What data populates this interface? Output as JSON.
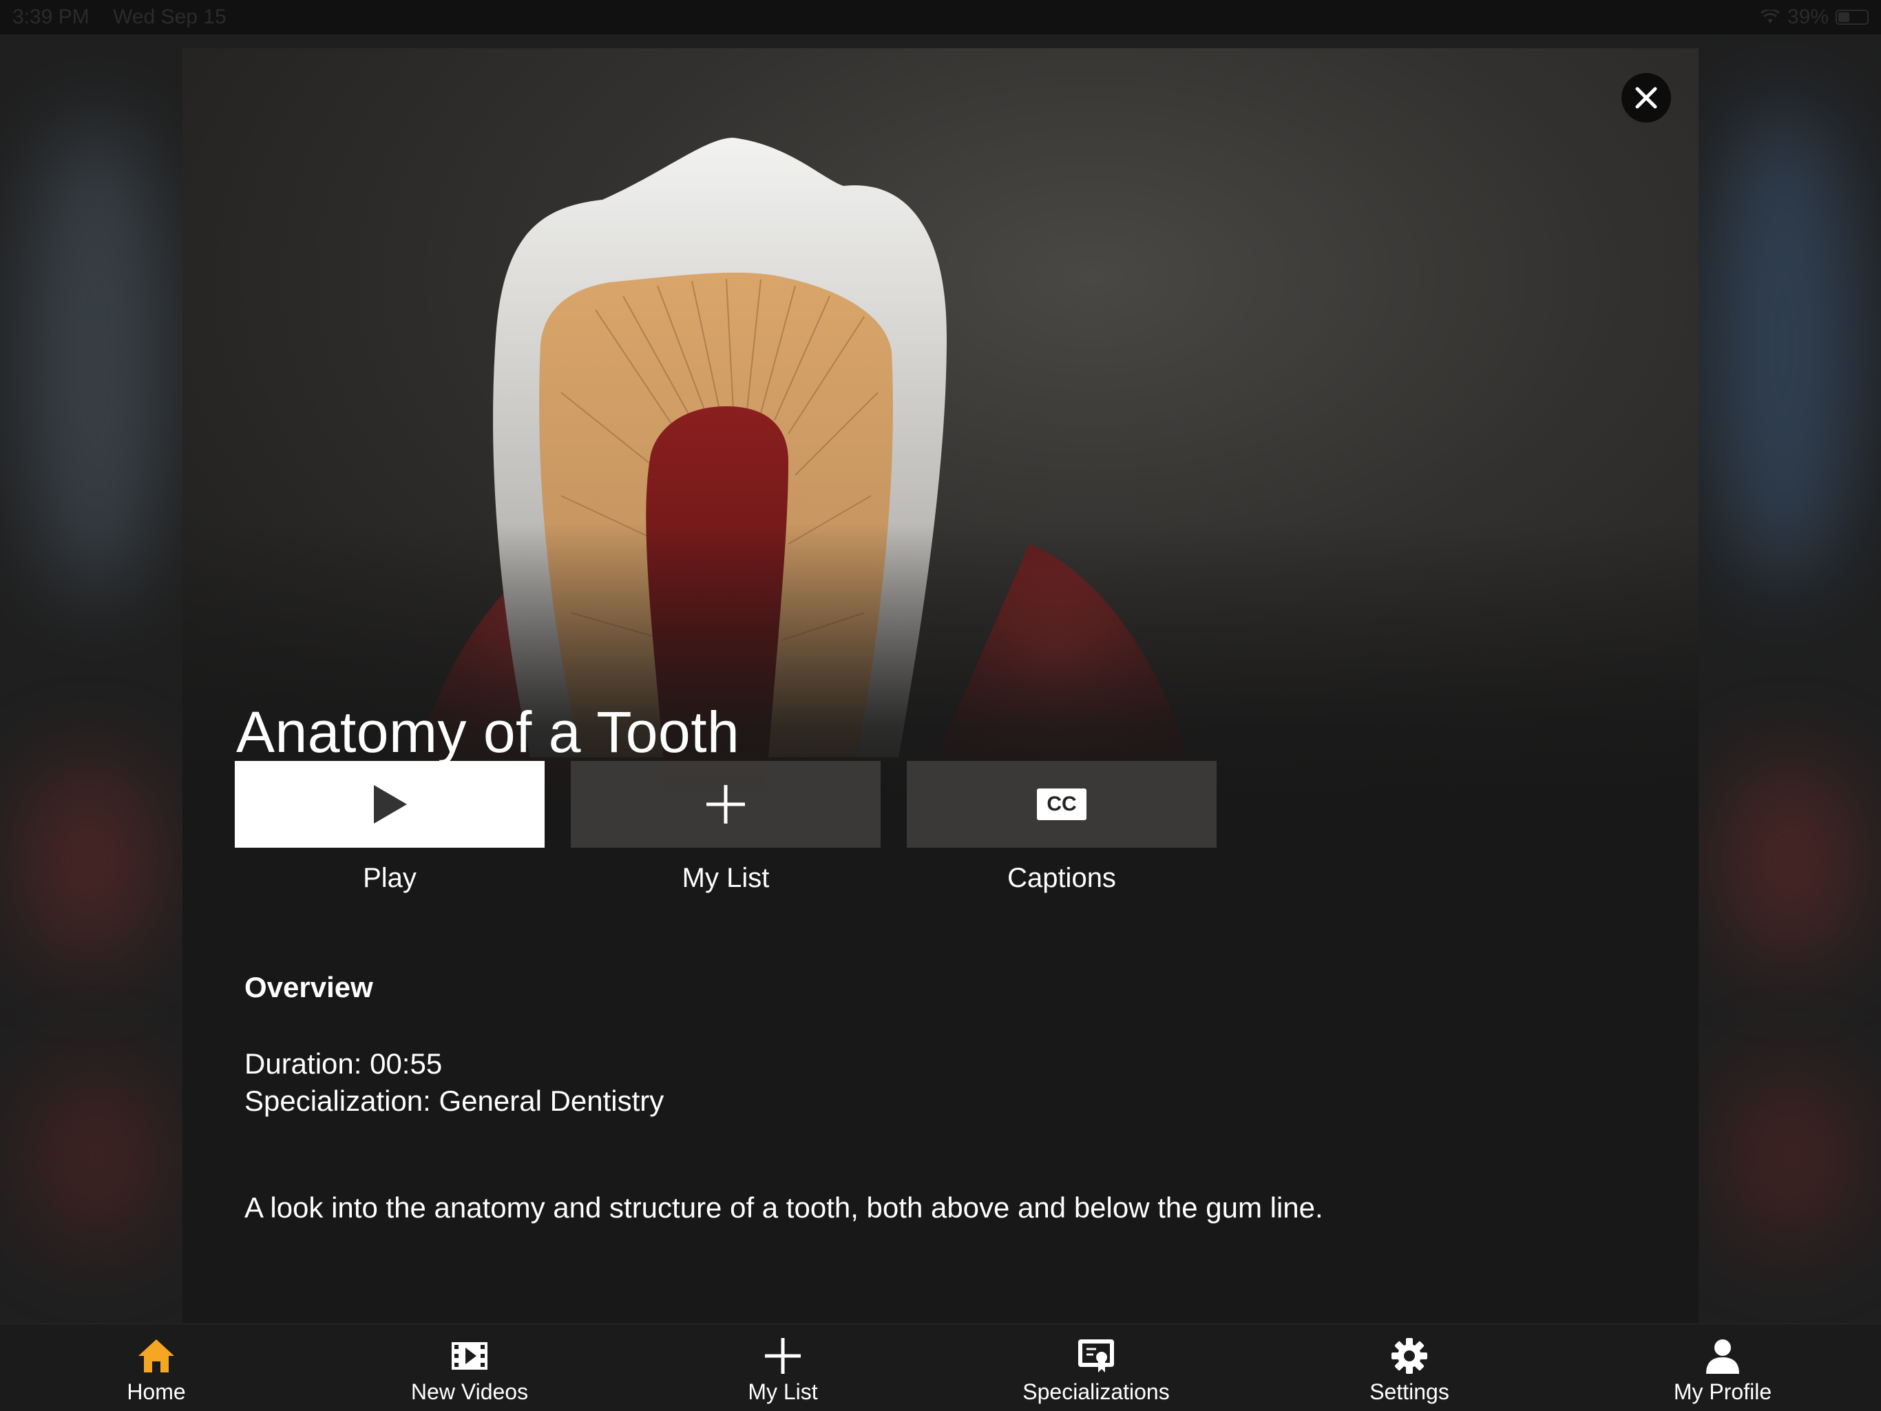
{
  "status_bar": {
    "time": "3:39 PM",
    "date": "Wed Sep 15",
    "battery": "39%"
  },
  "modal": {
    "title": "Anatomy of a Tooth",
    "actions": [
      {
        "label": "Play",
        "icon": "play-icon"
      },
      {
        "label": "My List",
        "icon": "plus-icon"
      },
      {
        "label": "Captions",
        "icon": "closed-captions-icon",
        "badge": "CC"
      }
    ],
    "overview": {
      "heading": "Overview",
      "duration": "Duration: 00:55",
      "specialization": "Specialization: General Dentistry",
      "description": "A look into the anatomy and structure of a tooth, both above and below the gum line."
    }
  },
  "tabbar": {
    "items": [
      {
        "label": "Home",
        "icon": "home-icon",
        "active": true
      },
      {
        "label": "New Videos",
        "icon": "film-icon"
      },
      {
        "label": "My List",
        "icon": "plus-icon"
      },
      {
        "label": "Specializations",
        "icon": "certificate-icon"
      },
      {
        "label": "Settings",
        "icon": "gear-icon"
      },
      {
        "label": "My Profile",
        "icon": "person-icon"
      }
    ]
  },
  "colors": {
    "accent": "#f5a623",
    "background": "#181818",
    "play_button": "#ffffff"
  }
}
